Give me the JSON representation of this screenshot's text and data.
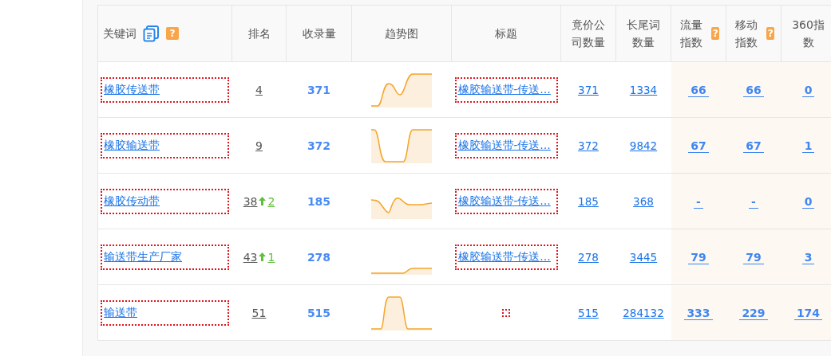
{
  "table": {
    "columns": [
      {
        "label": "关键词",
        "copy_icon": true,
        "help": "?"
      },
      {
        "label": "排名"
      },
      {
        "label": "收录量"
      },
      {
        "label": "趋势图"
      },
      {
        "label": "标题"
      },
      {
        "label": "竟价公司数量"
      },
      {
        "label": "长尾词数量"
      },
      {
        "label": "流量指数",
        "help": "?"
      },
      {
        "label": "移动指数",
        "help": "?"
      },
      {
        "label": "360指数"
      }
    ],
    "rows": [
      {
        "keyword": "橡胶传送带",
        "rank": "4",
        "indexed": "371",
        "title": "橡胶输送带-传送…",
        "bid_companies": "371",
        "long_tail": "1334",
        "traffic_index": "66",
        "mobile_index": "66",
        "index_360": "0"
      },
      {
        "keyword": "橡胶输送带",
        "rank": "9",
        "indexed": "372",
        "title": "橡胶输送带-传送…",
        "bid_companies": "372",
        "long_tail": "9842",
        "traffic_index": "67",
        "mobile_index": "67",
        "index_360": "1"
      },
      {
        "keyword": "橡胶传动带",
        "rank": "38",
        "rank_change": "2",
        "indexed": "185",
        "title": "橡胶输送带-传送…",
        "bid_companies": "185",
        "long_tail": "368",
        "traffic_index": "-",
        "mobile_index": "-",
        "index_360": "0"
      },
      {
        "keyword": "输送带生产厂家",
        "rank": "43",
        "rank_change": "1",
        "indexed": "278",
        "title": "橡胶输送带-传送…",
        "bid_companies": "278",
        "long_tail": "3445",
        "traffic_index": "79",
        "mobile_index": "79",
        "index_360": "3"
      },
      {
        "keyword": "输送带",
        "rank": "51",
        "indexed": "515",
        "bid_companies": "515",
        "long_tail": "284132",
        "traffic_index": "333",
        "mobile_index": "229",
        "index_360": "174"
      }
    ]
  }
}
